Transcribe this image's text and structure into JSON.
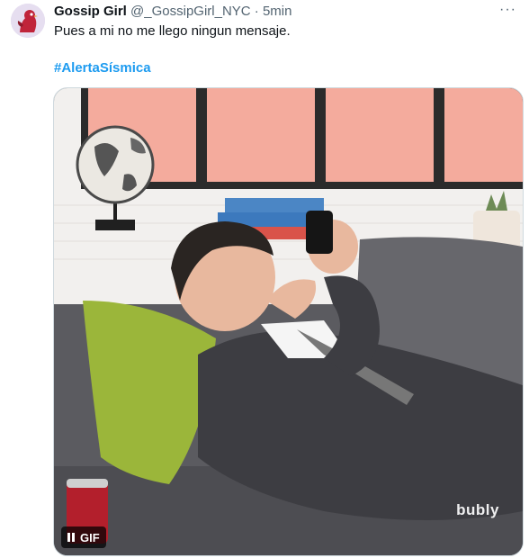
{
  "tweet": {
    "author_name": "Gossip Girl",
    "handle": "@_GossipGirl_NYC",
    "separator": "·",
    "time": "5min",
    "more_label": "···",
    "text": "Pues a mi no me llego ningun mensaje.",
    "hashtag": "#AlertaSísmica"
  },
  "media": {
    "badge_label": "GIF",
    "pause_icon": "pause-icon",
    "watermark": "bubly"
  },
  "colors": {
    "link": "#1d9bf0",
    "secondary_text": "#536471",
    "primary_text": "#0f1419"
  }
}
